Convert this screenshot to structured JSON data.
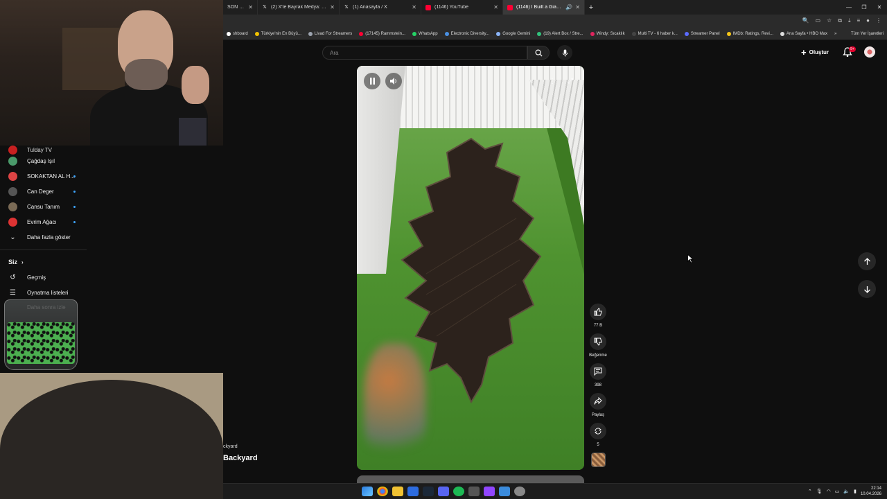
{
  "browser": {
    "tabs": [
      {
        "label": "SON DAKİKA",
        "icon": "x-icon",
        "active": false
      },
      {
        "label": "(2) X'te Bayrak Medya: \"Türkiye",
        "icon": "x-icon",
        "active": false
      },
      {
        "label": "(1) Anasayfa / X",
        "icon": "x-icon",
        "active": false
      },
      {
        "label": "(1146) YouTube",
        "icon": "youtube-icon",
        "active": false
      },
      {
        "label": "(1146) I Built a Giant Bat Ga",
        "icon": "youtube-icon",
        "active": true
      }
    ],
    "bookmarks": [
      {
        "label": "shboard",
        "color": "#ffffff"
      },
      {
        "label": "Türkiye'nin En Büyü...",
        "color": "#f2c200"
      },
      {
        "label": "Livad For Streamers",
        "color": "#9ca3af"
      },
      {
        "label": "(17145) Rammstein...",
        "color": "#ff0033"
      },
      {
        "label": "WhatsApp",
        "color": "#25d366"
      },
      {
        "label": "Electronic Diversity...",
        "color": "#4a90e2"
      },
      {
        "label": "Google Gemini",
        "color": "#8ab4f8"
      },
      {
        "label": "(19) Alert Box / Stre...",
        "color": "#31c27c"
      },
      {
        "label": "Windy: Sıcaklık",
        "color": "#e0245e"
      },
      {
        "label": "Multi TV - 6 haber k...",
        "color": "#444444"
      },
      {
        "label": "Streamer Panel",
        "color": "#5b6bff"
      },
      {
        "label": "IMDb: Ratings, Revi...",
        "color": "#f5c518"
      },
      {
        "label": "Ana Sayfa • HBO Max",
        "color": "#dddddd"
      },
      {
        "label": "»",
        "color": ""
      },
      {
        "label": "Tüm Yer İşaretleri",
        "color": ""
      }
    ]
  },
  "sidebar": {
    "partial_item": "Tulday TV",
    "subscriptions": [
      {
        "label": "Çağdaş Işıl",
        "color": "#4a9a6a",
        "live": false
      },
      {
        "label": "SOKAKTAN AL H...",
        "color": "#d44",
        "live": true
      },
      {
        "label": "Can Deger",
        "color": "#555",
        "live": true
      },
      {
        "label": "Cansu Tanım",
        "color": "#7a6a55",
        "live": true
      },
      {
        "label": "Evrim Ağacı",
        "color": "#d33",
        "live": true
      }
    ],
    "show_more": "Daha fazla göster",
    "section_you": "Siz",
    "you_items": [
      {
        "label": "Geçmiş",
        "icon": "history-icon"
      },
      {
        "label": "Oynatma listeleri",
        "icon": "playlist-icon"
      }
    ],
    "faded_item": "Daha sonra izle"
  },
  "topbar": {
    "search_placeholder": "Ara",
    "create_label": "Oluştur",
    "notifications_badge": "9+"
  },
  "short": {
    "channel": "ckyard",
    "title": "Backyard",
    "likes": "77 B",
    "dislike_label": "Beğenme",
    "comments": "398",
    "share_label": "Paylaş",
    "remix_count": "5"
  },
  "taskbar": {
    "time": "22:14",
    "date": "10.04.2026"
  },
  "colors": {
    "accent_red": "#ff0033",
    "live_blue": "#3ea6ff",
    "background": "#0f0f0f"
  }
}
